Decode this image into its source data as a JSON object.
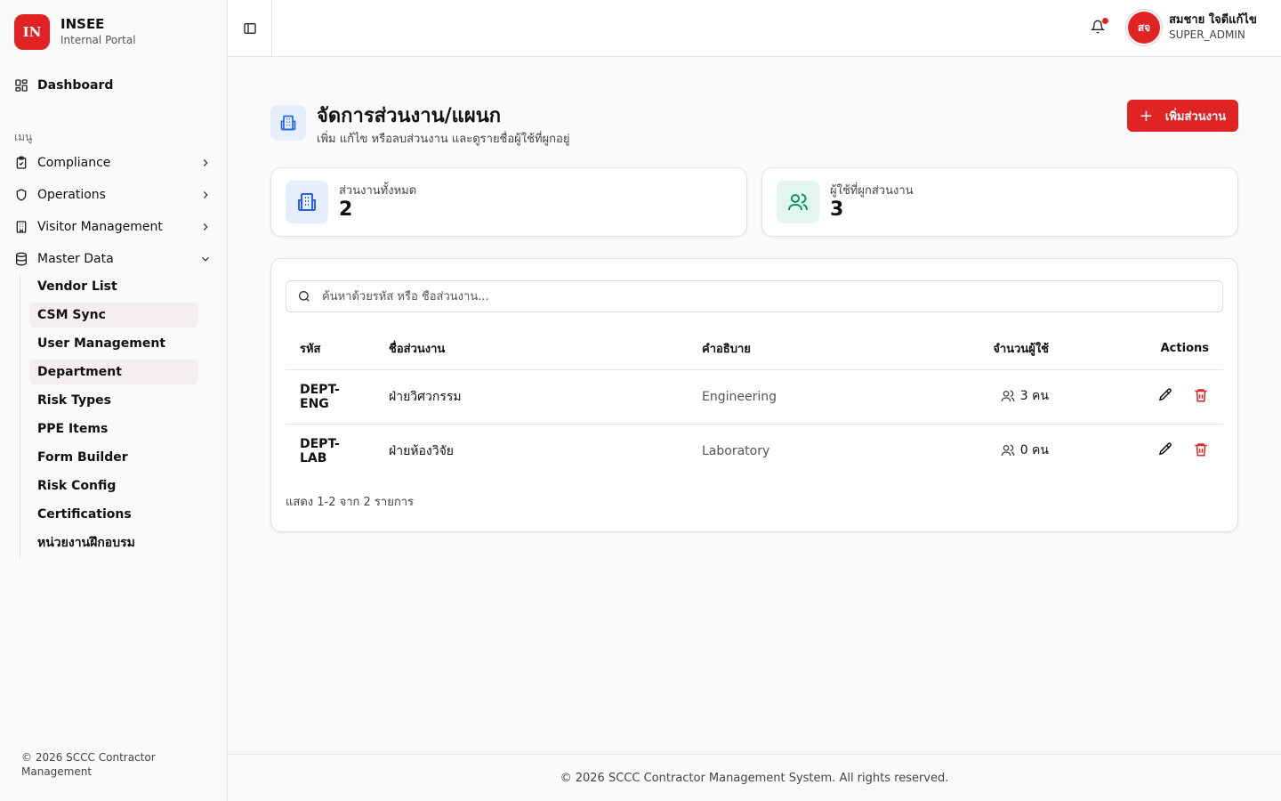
{
  "brand": {
    "logo": "IN",
    "name": "INSEE",
    "subtitle": "Internal Portal"
  },
  "sidebar": {
    "dashboard": {
      "label": "Dashboard",
      "icon": "layout-grid-icon"
    },
    "menu_heading": "เมนู",
    "items": [
      {
        "label": "Compliance",
        "icon": "clipboard-check-icon",
        "expanded": false
      },
      {
        "label": "Operations",
        "icon": "shield-icon",
        "expanded": false
      },
      {
        "label": "Visitor Management",
        "icon": "building-icon",
        "expanded": false
      },
      {
        "label": "Master Data",
        "icon": "database-icon",
        "expanded": true
      }
    ],
    "submenu": [
      {
        "label": "Vendor List"
      },
      {
        "label": "CSM Sync"
      },
      {
        "label": "User Management"
      },
      {
        "label": "Department"
      },
      {
        "label": "Risk Types"
      },
      {
        "label": "PPE Items"
      },
      {
        "label": "Form Builder"
      },
      {
        "label": "Risk Config"
      },
      {
        "label": "Certifications"
      },
      {
        "label": "หน่วยงานฝึกอบรม"
      }
    ],
    "footer": "© 2026 SCCC Contractor Management"
  },
  "header": {
    "user": {
      "initials": "สจ",
      "name": "สมชาย ใจดีแก้ไข",
      "role": "SUPER_ADMIN"
    },
    "notification_dot": true
  },
  "page": {
    "title": "จัดการส่วนงาน/แผนก",
    "subtitle": "เพิ่ม แก้ไข หรือลบส่วนงาน และดูรายชื่อผู้ใช้ที่ผูกอยู่",
    "add_button": "เพิ่มส่วนงาน"
  },
  "stats": [
    {
      "label": "ส่วนงานทั้งหมด",
      "value": "2",
      "icon": "building-icon",
      "color": "#2563eb",
      "bg": "#e6eefc"
    },
    {
      "label": "ผู้ใช้ที่ผูกส่วนงาน",
      "value": "3",
      "icon": "users-icon",
      "color": "#059669",
      "bg": "#e3f6ee"
    }
  ],
  "search": {
    "placeholder": "ค้นหาด้วยรหัส หรือ ชื่อส่วนงาน..."
  },
  "table": {
    "headers": {
      "code": "รหัส",
      "name": "ชื่อส่วนงาน",
      "desc": "คำอธิบาย",
      "count": "จำนวนผู้ใช้",
      "actions": "Actions"
    },
    "rows": [
      {
        "code": "DEPT-ENG",
        "name": "ฝ่ายวิศวกรรม",
        "desc": "Engineering",
        "count": "3 คน"
      },
      {
        "code": "DEPT-LAB",
        "name": "ฝ่ายห้องวิจัย",
        "desc": "Laboratory",
        "count": "0 คน"
      }
    ],
    "summary": "แสดง 1-2 จาก 2 รายการ"
  },
  "footer": "© 2026 SCCC Contractor Management System. All rights reserved.",
  "colors": {
    "accent": "#e02424",
    "delete": "#e02424"
  }
}
